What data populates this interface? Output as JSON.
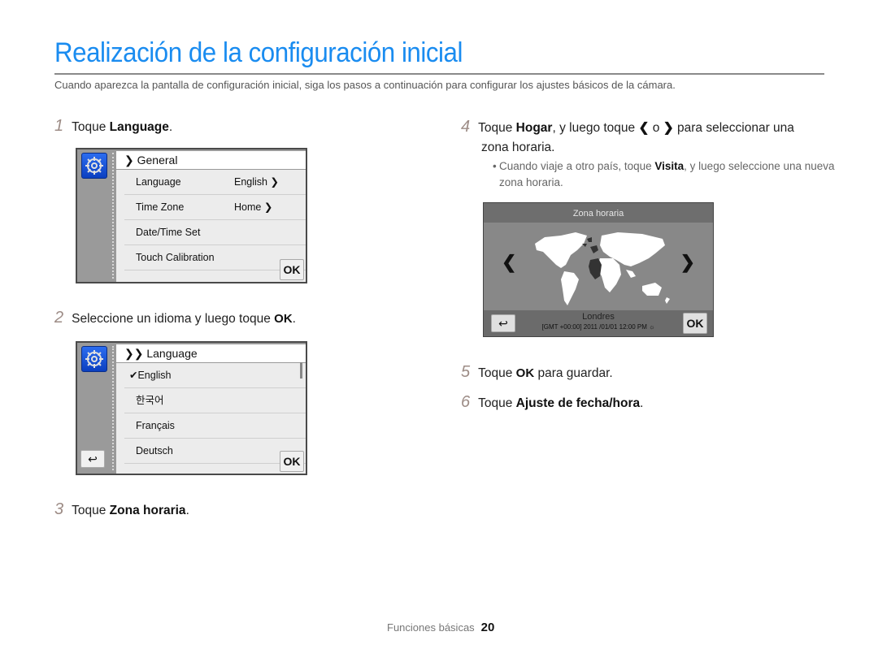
{
  "page": {
    "title": "Realización de la configuración inicial",
    "intro": "Cuando aparezca la pantalla de configuración inicial, siga los pasos a continuación para configurar los ajustes básicos de la cámara."
  },
  "steps": [
    {
      "num": "1",
      "prefix": "Toque ",
      "bold": "Language",
      "suffix": "."
    },
    {
      "num": "2",
      "prefix": "Seleccione un idioma y luego toque ",
      "bold": "OK",
      "suffix": "."
    },
    {
      "num": "3",
      "prefix": "Toque ",
      "bold": "Zona horaria",
      "suffix": "."
    },
    {
      "num": "4",
      "prefix": "Toque ",
      "bold": "Hogar",
      "mid": ", y luego toque ",
      "left_glyph": "❮",
      "or": " o ",
      "right_glyph": "❯",
      "suffix": " para seleccionar una",
      "line2": "zona horaria."
    },
    {
      "num": "5",
      "prefix": "Toque ",
      "bold": "OK",
      "suffix": " para guardar."
    },
    {
      "num": "6",
      "prefix": "Toque ",
      "bold": "Ajuste de fecha/hora",
      "suffix": "."
    }
  ],
  "step4_note": {
    "bullet": "•",
    "prefix": "Cuando viaje a otro país, toque ",
    "bold": "Visita",
    "suffix": ", y luego seleccione una nueva zona horaria."
  },
  "screen1": {
    "header": "❯ General",
    "rows": [
      {
        "label": "Language",
        "value": "English ❯"
      },
      {
        "label": "Time Zone",
        "value": "Home ❯"
      },
      {
        "label": "Date/Time Set",
        "value": ""
      },
      {
        "label": "Touch Calibration",
        "value": ""
      }
    ],
    "ok_label": "OK",
    "icon": "gear-icon"
  },
  "screen2": {
    "header": "❯❯ Language",
    "rows": [
      {
        "label": "✔English"
      },
      {
        "label": "한국어"
      },
      {
        "label": "Français"
      },
      {
        "label": "Deutsch"
      }
    ],
    "ok_label": "OK",
    "back_label": "↩",
    "icon": "gear-icon"
  },
  "screen3": {
    "header": "Zona horaria",
    "left_arrow": "❮",
    "right_arrow": "❯",
    "city": "Londres",
    "gmt": "[GMT +00:00] 2011 /01/01 12:00 PM ☼",
    "ok_label": "OK",
    "back_label": "↩"
  },
  "footer": {
    "section": "Funciones básicas",
    "page": "20"
  }
}
